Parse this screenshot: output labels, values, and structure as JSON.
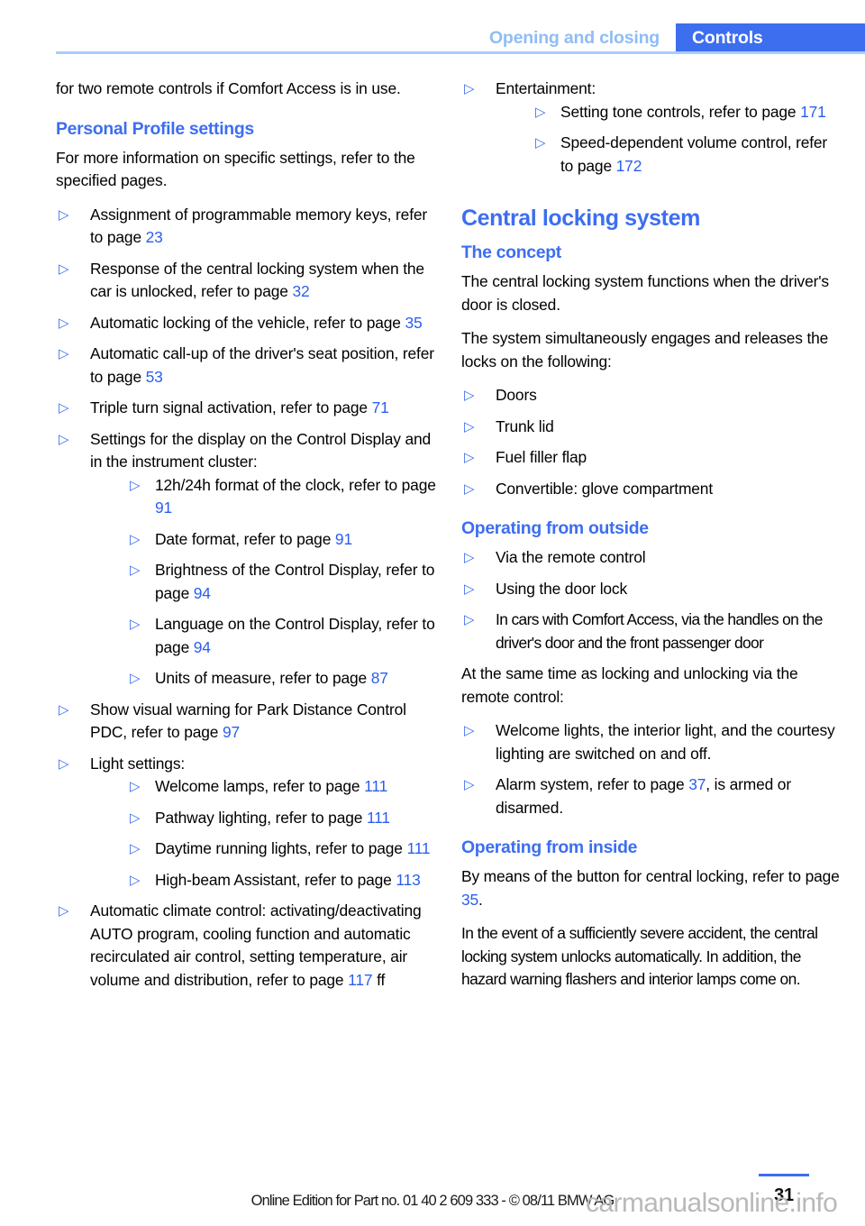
{
  "header": {
    "chapter": "Opening and closing",
    "section": "Controls"
  },
  "left_column": {
    "intro_paragraph": "for two remote controls if Comfort Access is in use.",
    "heading_personal_profile": "Personal Profile settings",
    "personal_profile_intro": "For more information on specific settings, refer to the specified pages.",
    "items": [
      {
        "text_before": "Assignment of programmable memory keys, refer to page ",
        "page": "23",
        "text_after": ""
      },
      {
        "text_before": "Response of the central locking system when the car is unlocked, refer to page ",
        "page": "32",
        "text_after": ""
      },
      {
        "text_before": "Automatic locking of the vehicle, refer to page ",
        "page": "35",
        "text_after": ""
      },
      {
        "text_before": "Automatic call-up of the driver's seat position, refer to page ",
        "page": "53",
        "text_after": ""
      },
      {
        "text_before": "Triple turn signal activation, refer to page ",
        "page": "71",
        "text_after": ""
      }
    ],
    "display_settings": {
      "text_before": "Settings for the display on the Control Display and in the instrument cluster:",
      "sub_items": [
        {
          "text_before": "12h/24h format of the clock, refer to page ",
          "page": "91",
          "text_after": ""
        },
        {
          "text_before": "Date format, refer to page ",
          "page": "91",
          "text_after": ""
        },
        {
          "text_before": "Brightness of the Control Display, refer to page ",
          "page": "94",
          "text_after": ""
        },
        {
          "text_before": "Language on the Control Display, refer to page ",
          "page": "94",
          "text_after": ""
        },
        {
          "text_before": "Units of measure, refer to page ",
          "page": "87",
          "text_after": ""
        }
      ]
    },
    "pdc_item": {
      "text_before": "Show visual warning for Park Distance Control PDC, refer to page ",
      "page": "97",
      "text_after": ""
    },
    "light_settings": {
      "text_before": "Light settings:",
      "sub_items": [
        {
          "text_before": "Welcome lamps, refer to page ",
          "page": "111",
          "text_after": ""
        },
        {
          "text_before": "Pathway lighting, refer to page ",
          "page": "111",
          "text_after": ""
        },
        {
          "text_before": "Daytime running lights, refer to page ",
          "page": "111",
          "text_after": ""
        },
        {
          "text_before": "High-beam Assistant, refer to page ",
          "page": "113",
          "text_after": ""
        }
      ]
    },
    "climate_item": {
      "text_before": "Automatic climate control: activating/deactivating AUTO program, cooling function and automatic recirculated air control, setting temperature, air volume and distribution, refer to page ",
      "page": "117",
      "text_after": " ff"
    }
  },
  "right_column": {
    "entertainment": {
      "text_before": "Entertainment:",
      "sub_items": [
        {
          "text_before": "Setting tone controls, refer to page ",
          "page": "171",
          "text_after": ""
        },
        {
          "text_before": "Speed-dependent volume control, refer to page ",
          "page": "172",
          "text_after": ""
        }
      ]
    },
    "heading_central_locking": "Central locking system",
    "heading_the_concept": "The concept",
    "concept_paragraph_1": "The central locking system functions when the driver's door is closed.",
    "concept_paragraph_2": "The system simultaneously engages and releases the locks on the following:",
    "concept_items": [
      {
        "text_before": "Doors",
        "page": "",
        "text_after": ""
      },
      {
        "text_before": "Trunk lid",
        "page": "",
        "text_after": ""
      },
      {
        "text_before": "Fuel filler flap",
        "page": "",
        "text_after": ""
      },
      {
        "text_before": "Convertible: glove compartment",
        "page": "",
        "text_after": ""
      }
    ],
    "heading_operating_outside": "Operating from outside",
    "outside_items": [
      {
        "text_before": "Via the remote control",
        "page": "",
        "text_after": ""
      },
      {
        "text_before": "Using the door lock",
        "page": "",
        "text_after": ""
      },
      {
        "text_before": "In cars with Comfort Access, via the handles on the driver's door and the front passenger door",
        "page": "",
        "text_after": ""
      }
    ],
    "outside_paragraph": "At the same time as locking and unlocking via the remote control:",
    "outside_sub_items": [
      {
        "text_before": "Welcome lights, the interior light, and the courtesy lighting are switched on and off.",
        "page": "",
        "text_after": ""
      },
      {
        "text_before": "Alarm system, refer to page ",
        "page": "37",
        "text_after": ", is armed or disarmed."
      }
    ],
    "heading_operating_inside": "Operating from inside",
    "inside_paragraph_1_before": "By means of the button for central locking, refer to page ",
    "inside_paragraph_1_page": "35",
    "inside_paragraph_1_after": ".",
    "inside_paragraph_2": "In the event of a sufficiently severe accident, the central locking system unlocks automatically. In addition, the hazard warning flashers and interior lamps come on."
  },
  "footer": {
    "edition": "Online Edition for Part no. 01 40 2 609 333 - © 08/11 BMW AG",
    "page_number": "31",
    "watermark": "carmanualsonline.info"
  },
  "icons": {
    "bullet": "▷"
  },
  "colors": {
    "accent_blue": "#3d6ef0",
    "link_blue": "#2b5ef0",
    "header_chapter_blue": "#8fbdf5",
    "header_rule_blue": "#a8cdfb"
  }
}
